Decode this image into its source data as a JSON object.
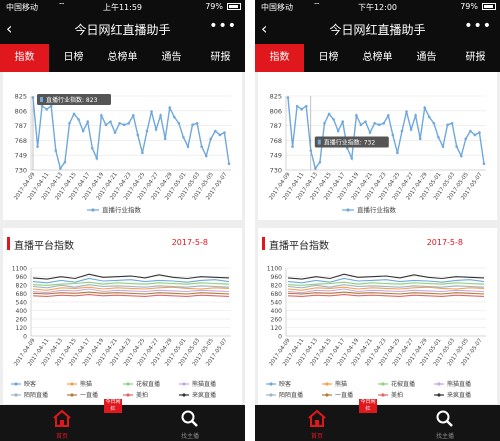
{
  "status_bar": {
    "carrier": "中国移动",
    "battery": "79%"
  },
  "header": {
    "title": "今日网红直播助手"
  },
  "tabs": [
    "指数",
    "日榜",
    "总榜单",
    "通告",
    "研报"
  ],
  "active_tab_index": 0,
  "screens": [
    {
      "time": "上午11:59",
      "tooltip": "直播行业指数: 823",
      "tooltip_index": 0
    },
    {
      "time": "下午12:00",
      "tooltip": "直播行业指数: 732",
      "tooltip_index": 5
    }
  ],
  "industry_chart": {
    "series_name": "直播行业指数",
    "line_color": "#6fa8dc",
    "y_ticks": [
      "825",
      "806",
      "787",
      "768",
      "749",
      "730"
    ],
    "y_min": 730,
    "y_max": 825,
    "x_labels": [
      "2017-04-09",
      "2017-04-11",
      "2017-04-13",
      "2017-04-15",
      "2017-04-17",
      "2017-04-19",
      "2017-04-21",
      "2017-04-23",
      "2017-04-25",
      "2017-04-27",
      "2017-04-29",
      "2017-05-01",
      "2017-05-03",
      "2017-05-05",
      "2017-05-07"
    ],
    "values": [
      823,
      760,
      812,
      808,
      812,
      755,
      732,
      740,
      790,
      802,
      795,
      780,
      792,
      758,
      745,
      800,
      788,
      792,
      778,
      790,
      788,
      790,
      800,
      775,
      752,
      780,
      805,
      782,
      800,
      770,
      810,
      798,
      790,
      772,
      760,
      788,
      790,
      760,
      748,
      770,
      780,
      775,
      778,
      738
    ]
  },
  "platform_card": {
    "title": "直播平台指数",
    "date": "2017-5-8"
  },
  "platform_chart": {
    "y_ticks": [
      "1100",
      "960",
      "820",
      "680",
      "540",
      "400",
      "260",
      "120",
      "0"
    ],
    "y_max": 1100,
    "x_labels": [
      "2017-04-09",
      "2017-04-11",
      "2017-04-13",
      "2017-04-15",
      "2017-04-17",
      "2017-04-19",
      "2017-04-21",
      "2017-04-23",
      "2017-04-25",
      "2017-04-27",
      "2017-04-29",
      "2017-05-01",
      "2017-05-03",
      "2017-05-05",
      "2017-05-07"
    ],
    "series": [
      {
        "name": "映客",
        "color": "#6fa8dc",
        "values": [
          880,
          860,
          900,
          870,
          930,
          890,
          900,
          910,
          880,
          900,
          890,
          870,
          900,
          910,
          880
        ]
      },
      {
        "name": "熊猫",
        "color": "#f6a04d",
        "values": [
          760,
          740,
          780,
          770,
          790,
          760,
          780,
          770,
          760,
          780,
          790,
          770,
          760,
          780,
          770
        ]
      },
      {
        "name": "花椒直播",
        "color": "#8fd07a",
        "values": [
          830,
          820,
          840,
          850,
          870,
          840,
          860,
          850,
          840,
          860,
          850,
          840,
          860,
          850,
          840
        ]
      },
      {
        "name": "熊猫直播",
        "color": "#c6a8e0",
        "values": [
          720,
          700,
          740,
          730,
          760,
          720,
          740,
          730,
          720,
          740,
          730,
          720,
          740,
          730,
          720
        ]
      },
      {
        "name": "陌陌直播",
        "color": "#9fb3c8",
        "values": [
          800,
          780,
          820,
          790,
          830,
          800,
          810,
          800,
          790,
          810,
          800,
          790,
          810,
          800,
          790
        ]
      },
      {
        "name": "一直播",
        "color": "#b57a3a",
        "values": [
          690,
          680,
          700,
          690,
          710,
          690,
          700,
          690,
          680,
          700,
          690,
          680,
          700,
          690,
          680
        ]
      },
      {
        "name": "美拍",
        "color": "#e06666",
        "values": [
          650,
          640,
          660,
          650,
          670,
          650,
          660,
          650,
          640,
          660,
          650,
          640,
          660,
          650,
          640
        ]
      },
      {
        "name": "来疯直播",
        "color": "#333333",
        "values": [
          940,
          920,
          960,
          930,
          1000,
          950,
          960,
          970,
          940,
          990,
          950,
          930,
          960,
          950,
          940
        ]
      }
    ],
    "legend": [
      [
        "映客",
        "熊猫",
        "花椒直播",
        "熊猫直播"
      ],
      [
        "陌陌直播",
        "一直播",
        "美拍",
        "来疯直播"
      ]
    ]
  },
  "bottom_nav": {
    "home": "首页",
    "search": "找主播",
    "logo": "今日网红"
  }
}
